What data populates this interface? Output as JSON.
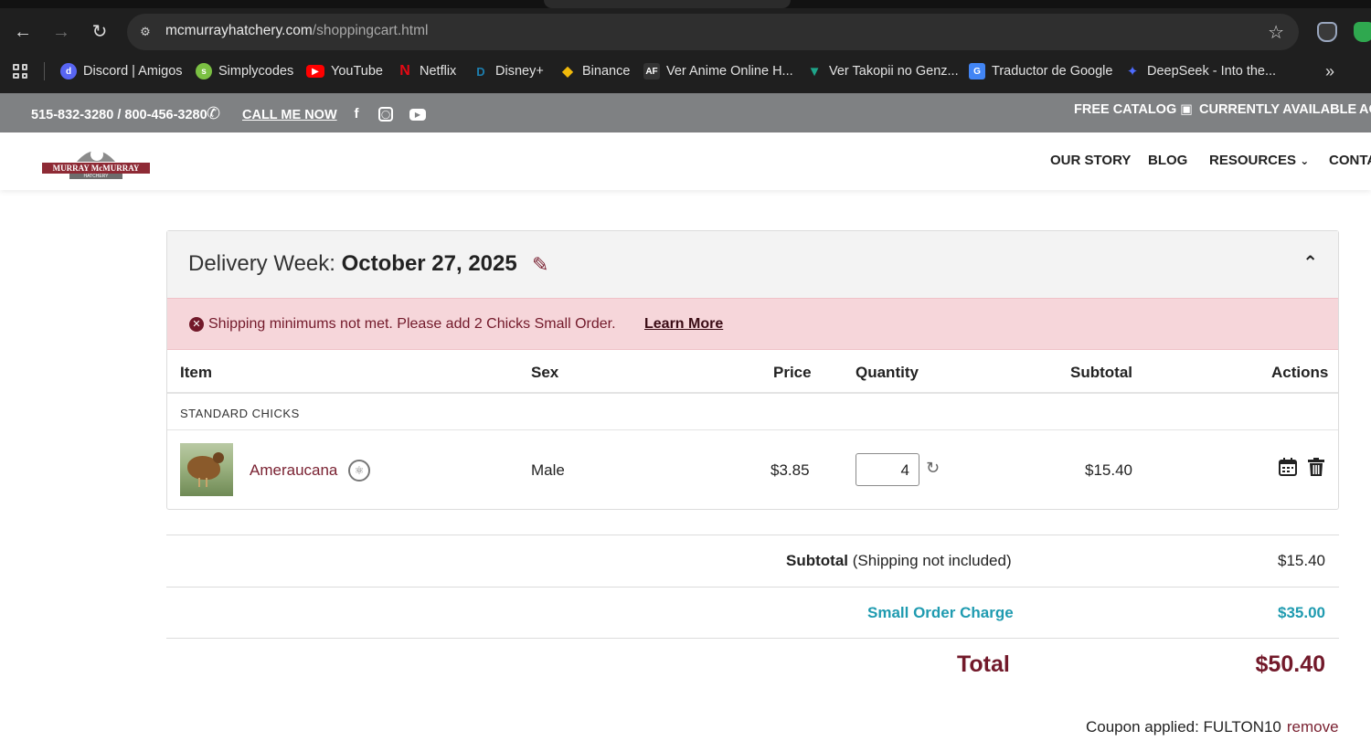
{
  "browser": {
    "url_domain": "mcmurrayhatchery.com",
    "url_path": "/shoppingcart.html",
    "bookmarks": [
      {
        "label": "Discord | Amigos",
        "icon": "discord-icon",
        "color": "#5865f2"
      },
      {
        "label": "Simplycodes",
        "icon": "simplycodes-icon",
        "color": "#7bc043"
      },
      {
        "label": "YouTube",
        "icon": "youtube-icon",
        "color": "#ff0000"
      },
      {
        "label": "Netflix",
        "icon": "netflix-icon",
        "color": "#e50914"
      },
      {
        "label": "Disney+",
        "icon": "disney-icon",
        "color": "#1d5e8c"
      },
      {
        "label": "Binance",
        "icon": "binance-icon",
        "color": "#f0b90b"
      },
      {
        "label": "Ver Anime Online H...",
        "icon": "animeflv-icon",
        "color": "#333333"
      },
      {
        "label": "Ver Takopii no Genz...",
        "icon": "takopii-icon",
        "color": "#1fa58a"
      },
      {
        "label": "Traductor de Google",
        "icon": "google-translate-icon",
        "color": "#4285f4"
      },
      {
        "label": "DeepSeek - Into the...",
        "icon": "deepseek-icon",
        "color": "#4d6bfe"
      }
    ]
  },
  "topbar": {
    "phone": "515-832-3280 / 800-456-3280",
    "call_me": "CALL ME NOW",
    "free_catalog": "FREE CATALOG",
    "currently_available": "CURRENTLY AVAILABLE",
    "cut_link": "AC"
  },
  "nav": {
    "logo_text": "MURRAY McMURRAY",
    "logo_sub": "HATCHERY",
    "our_story": "OUR STORY",
    "blog": "BLOG",
    "resources": "RESOURCES",
    "contact": "CONTA"
  },
  "cart": {
    "delivery_label": "Delivery Week:",
    "delivery_date": "October 27, 2025",
    "alert_message": "Shipping minimums not met. Please add 2 Chicks Small Order.",
    "alert_link": "Learn More",
    "headers": {
      "item": "Item",
      "sex": "Sex",
      "price": "Price",
      "quantity": "Quantity",
      "subtotal": "Subtotal",
      "actions": "Actions"
    },
    "category": "STANDARD CHICKS",
    "line": {
      "name": "Ameraucana",
      "sex": "Male",
      "price": "$3.85",
      "quantity": "4",
      "subtotal": "$15.40"
    }
  },
  "totals": {
    "subtotal_label": "Subtotal",
    "subtotal_note": "(Shipping not included)",
    "subtotal_value": "$15.40",
    "small_order_label": "Small Order Charge",
    "small_order_value": "$35.00",
    "total_label": "Total",
    "total_value": "$50.40",
    "coupon_text": "Coupon applied: FULTON10",
    "coupon_remove": "remove"
  },
  "colors": {
    "brand": "#7a2232",
    "teal": "#1f9bb0",
    "alert_bg": "#f6d6da",
    "topbar": "#7f8183"
  }
}
